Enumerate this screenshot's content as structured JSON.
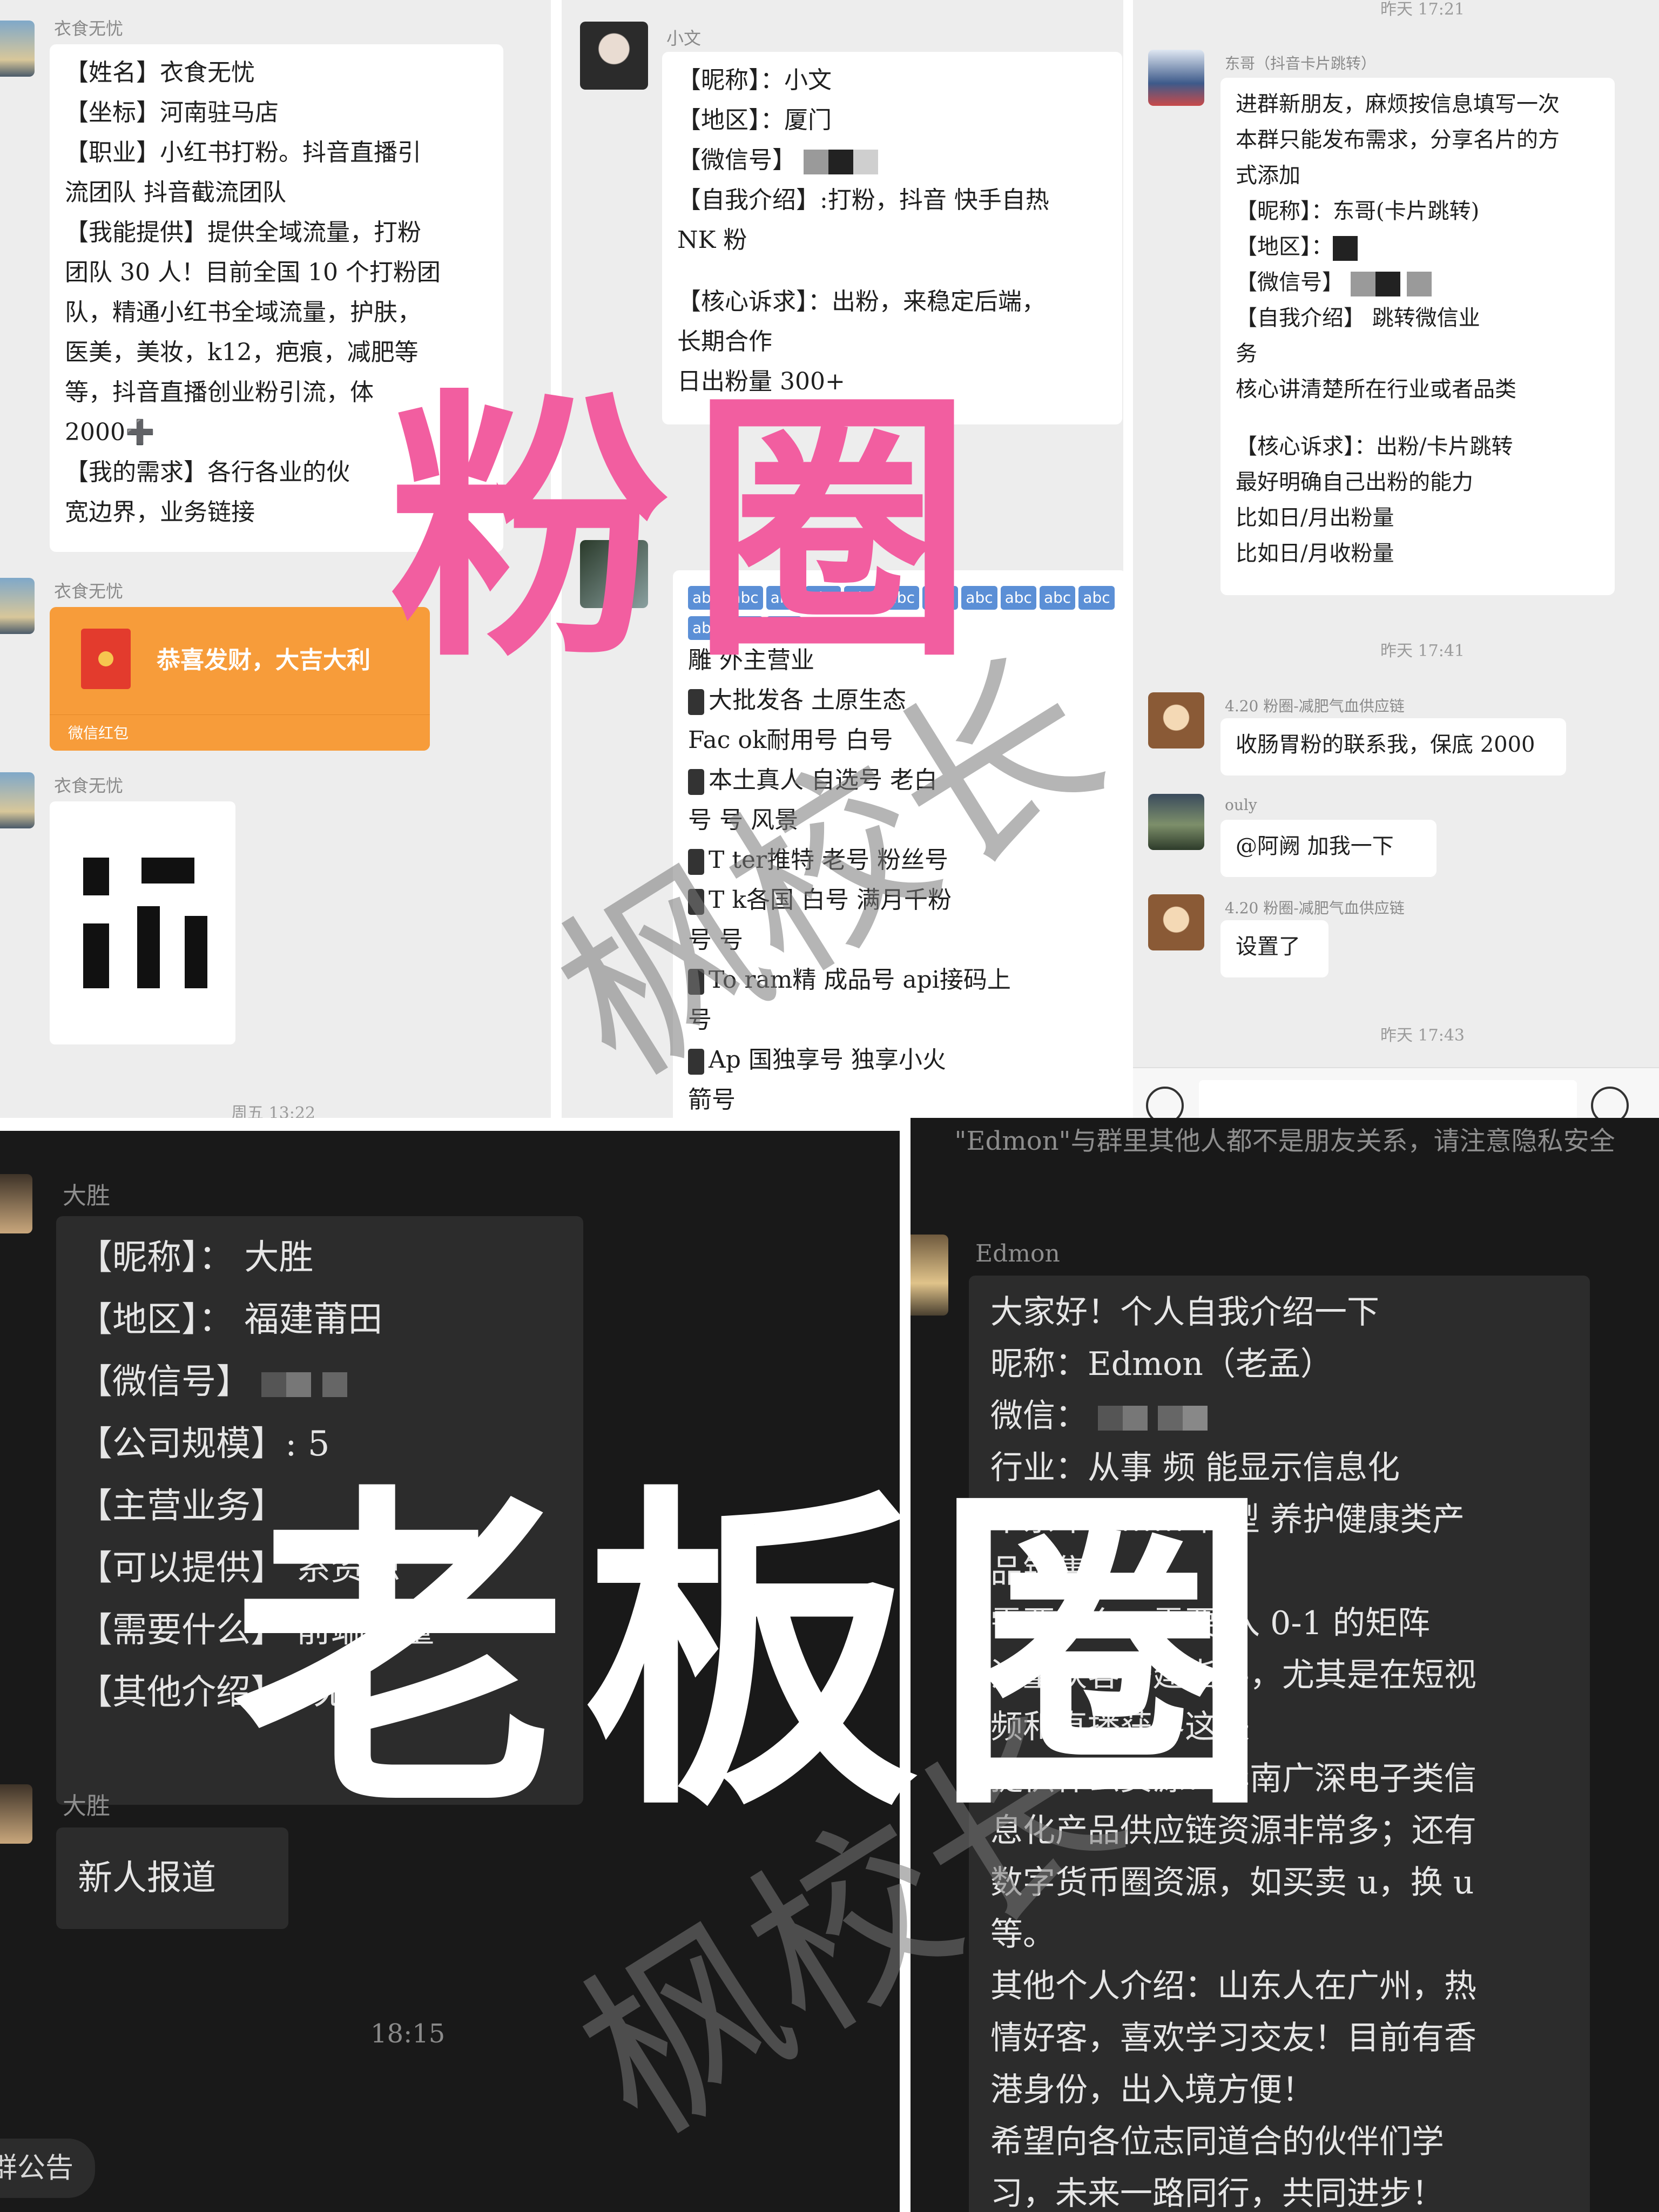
{
  "overlays": {
    "top_title": "粉圈",
    "bottom_title": "老板圈",
    "watermark": "枫校长"
  },
  "panel1": {
    "msg1": {
      "sender": "衣食无忧",
      "lines": [
        "【姓名】衣食无忧",
        "【坐标】河南驻马店",
        "【职业】小红书打粉。抖音直播引",
        "流团队 抖音截流团队",
        "【我能提供】提供全域流量，打粉",
        "团队 30 人！目前全国 10 个打粉团",
        "队，精通小红书全域流量，护肤，",
        "医美，美妆，k12，疤痕，减肥等",
        "等，抖音直播创业粉引流，体",
        "2000➕",
        "【我的需求】各行各业的伙",
        "宽边界，业务链接"
      ]
    },
    "msg2": {
      "sender": "衣食无忧",
      "redpacket_text": "恭喜发财，大吉大利",
      "redpacket_label": "微信红包"
    },
    "msg3": {
      "sender": "衣食无忧"
    },
    "time": "周五 13:22"
  },
  "panel2": {
    "msg1": {
      "sender": "小文",
      "lines": [
        "【昵称】：小文",
        "【地区】：厦门",
        "【微信号】",
        "【自我介绍】:打粉，抖音 快手自热",
        "NK 粉",
        "",
        "【核心诉求】：出粉，来稳定后端，",
        "长期合作",
        "日出粉量 300+"
      ]
    },
    "msg2": {
      "tag": "abc",
      "lines": [
        "雕 外主营业",
        "大批发各 土原生态",
        "Fac ok耐用号 白号",
        "本土真人 自选号 老白",
        "号 号 风景",
        "T ter推特 老号 粉丝号",
        "T k各国 白号 满月千粉",
        "号 号",
        "To ram精 成品号 api接码上",
        "号",
        "Ap 国独享号 独享小火",
        "箭号"
      ]
    }
  },
  "panel3": {
    "time_top": "昨天 17:21",
    "msg1": {
      "sender": "东哥（抖音卡片跳转）",
      "lines": [
        "进群新朋友，麻烦按信息填写一次",
        "本群只能发布需求，分享名片的方",
        "式添加",
        "【昵称】：东哥(卡片跳转)",
        "【地区】：",
        "【微信号】",
        "【自我介绍】 跳转微信业",
        "务",
        "核心讲清楚所在行业或者品类",
        "",
        "【核心诉求】：出粉/卡片跳转",
        "最好明确自己出粉的能力",
        "比如日/月出粉量",
        "比如日/月收粉量"
      ]
    },
    "time_mid": "昨天 17:41",
    "msg2": {
      "sender": "4.20 粉圈-减肥气血供应链",
      "text": "收肠胃粉的联系我，保底 2000"
    },
    "msg3": {
      "sender": "ouly",
      "text": "@阿阙 加我一下"
    },
    "msg4": {
      "sender": "4.20 粉圈-减肥气血供应链",
      "text": "设置了"
    },
    "time_bottom": "昨天 17:43"
  },
  "panel4": {
    "msg1": {
      "sender": "大胜",
      "lines": [
        "【昵称】： 大胜",
        "【地区】： 福建莆田",
        "【微信号】",
        "【公司规模】: 5",
        "【主营业务】",
        "【可以提供】 系资源",
        "【需要什么】 前端流量",
        "【其他介绍】： 无"
      ]
    },
    "msg2": {
      "sender": "大胜",
      "text": "新人报道"
    },
    "time": "18:15",
    "notice": "群公告"
  },
  "panel5": {
    "system_notice": "\"Edmon\"与群里其他人都不是朋友关系，请注意隐私安全",
    "msg1": {
      "sender": "Edmon",
      "lines": [
        "大家好！个人自我介绍一下",
        "昵称：Edmon（老孟）",
        "微信：",
        "行业：从事 频 能显示信息化",
        "十余年，…… 转型 养护健康类产",
        "品销售",
        "需要什么：需要 入 0-1 的矩阵",
        "流量获客搭建指导，尤其是在短视",
        "频和直播获客这块",
        "提供什么资源：华南广深电子类信",
        "息化产品供应链资源非常多；还有",
        "数字货币圈资源，如买卖 u，换 u",
        "等。",
        "其他个人介绍：山东人在广州，热",
        "情好客，喜欢学习交友！目前有香",
        "港身份，出入境方便！",
        "希望向各位志同道合的伙伴们学",
        "习，未来一路同行，共同进步！"
      ]
    }
  }
}
